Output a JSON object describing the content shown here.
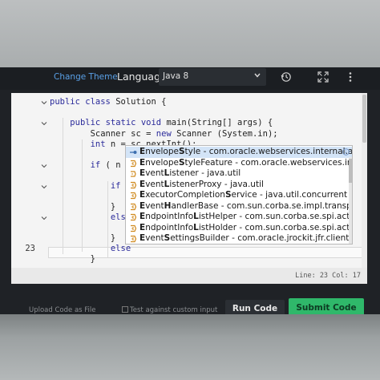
{
  "toolbar": {
    "change_theme": "Change Theme",
    "language_label": "Language",
    "language_value": "Java 8"
  },
  "gutter": {
    "current_line_number": "23"
  },
  "code_lines": [
    "public class Solution {",
    "",
    "    public static void main(String[] args) {",
    "        Scanner sc = new Scanner (System.in);",
    "        int n = sc.nextInt();",
    "",
    "        if ( n >",
    "",
    "            if (",
    "",
    "            }",
    "            else",
    "",
    "            }",
    "            else",
    "        }"
  ],
  "autocomplete": {
    "items": [
      {
        "pre": "",
        "b1": "E",
        "mid": "nvelope",
        "b2": "S",
        "post": "tyle - com.oracle.webservices.internal.api",
        "kind": "field"
      },
      {
        "pre": "",
        "b1": "E",
        "mid": "nvelope",
        "b2": "S",
        "post": "tyleFeature - com.oracle.webservices.interna...",
        "kind": "class"
      },
      {
        "pre": "",
        "b1": "E",
        "mid": "vent",
        "b2": "L",
        "post": "istener - java.util",
        "kind": "interface"
      },
      {
        "pre": "",
        "b1": "E",
        "mid": "vent",
        "b2": "L",
        "post": "istenerProxy - java.util",
        "kind": "class"
      },
      {
        "pre": "",
        "b1": "E",
        "mid": "xecutorCompletion",
        "b2": "S",
        "post": "ervice - java.util.concurrent",
        "kind": "class"
      },
      {
        "pre": "",
        "b1": "E",
        "mid": "vent",
        "b2": "H",
        "post": "andlerBase - com.sun.corba.se.impl.transport",
        "kind": "class"
      },
      {
        "pre": "",
        "b1": "E",
        "mid": "ndpointInfo",
        "b2": "L",
        "post": "istHelper - com.sun.corba.se.spi.activati...",
        "kind": "class"
      },
      {
        "pre": "",
        "b1": "E",
        "mid": "ndpointInfo",
        "b2": "L",
        "post": "istHolder - com.sun.corba.se.spi.activati...",
        "kind": "class"
      },
      {
        "pre": "",
        "b1": "E",
        "mid": "vent",
        "b2": "S",
        "post": "ettingsBuilder - com.oracle.jrockit.jfr.client",
        "kind": "class"
      }
    ]
  },
  "status": {
    "text": "Line: 23 Col: 17"
  },
  "bottom": {
    "upload": "Upload Code as File",
    "custom_input": "Test against custom input",
    "run": "Run Code",
    "submit": "Submit Code"
  },
  "colors": {
    "accent": "#5aa0e6",
    "submit": "#2fb86a",
    "selection": "#d3e4f7"
  }
}
